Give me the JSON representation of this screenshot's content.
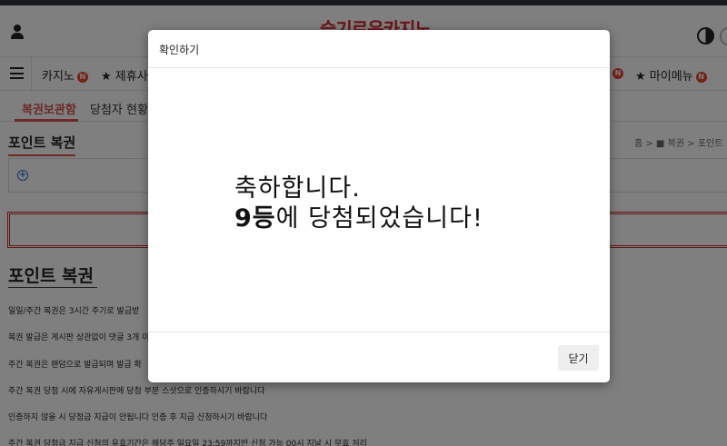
{
  "header": {
    "logo_text": "슬기로운카지노"
  },
  "nav": {
    "items": [
      {
        "label": "카지노",
        "badge": "N",
        "star": false
      },
      {
        "label": "★ 제휴사",
        "badge": "",
        "star": true
      },
      {
        "label": "★ 마이메뉴",
        "badge": "N",
        "star": true
      }
    ],
    "extra_badge": "N"
  },
  "subnav": {
    "items": [
      "복권보관함",
      "당첨자 현황"
    ]
  },
  "page": {
    "title": "포인트 복권",
    "breadcrumb": "홈 > ■ 복권 > 포인트",
    "section_title": "포인트 복권",
    "info_lines": [
      "일일/주간 복권은 3시간 주기로 발급받",
      "복권 발급은 게시판 상관없이 댓글 3개 이",
      "주간 복권은 랜덤으로 발급되며 발급 확",
      "주간 복권 당첨 시에 자유게시판에 당첨 부분 스샷으로 인증하시기 바랍니다",
      "인증하지 않을 시 당첨금 지급이 안됩니다 인증 후 지급 신청하시기 바랍니다",
      "주간 복권 당첨금 지급 신청의 유효기간은 해당주 일요일 23:59까지만 신청 가능 00시 지날 시 무효 처리"
    ]
  },
  "modal": {
    "title": "확인하기",
    "message_line1": "축하합니다.",
    "prize_rank": "9등",
    "message_line2_rest": "에 당첨되었습니다!",
    "close_label": "닫기"
  },
  "colors": {
    "accent": "#d9534f",
    "logo": "#d8262c",
    "badge": "#e8452c"
  }
}
